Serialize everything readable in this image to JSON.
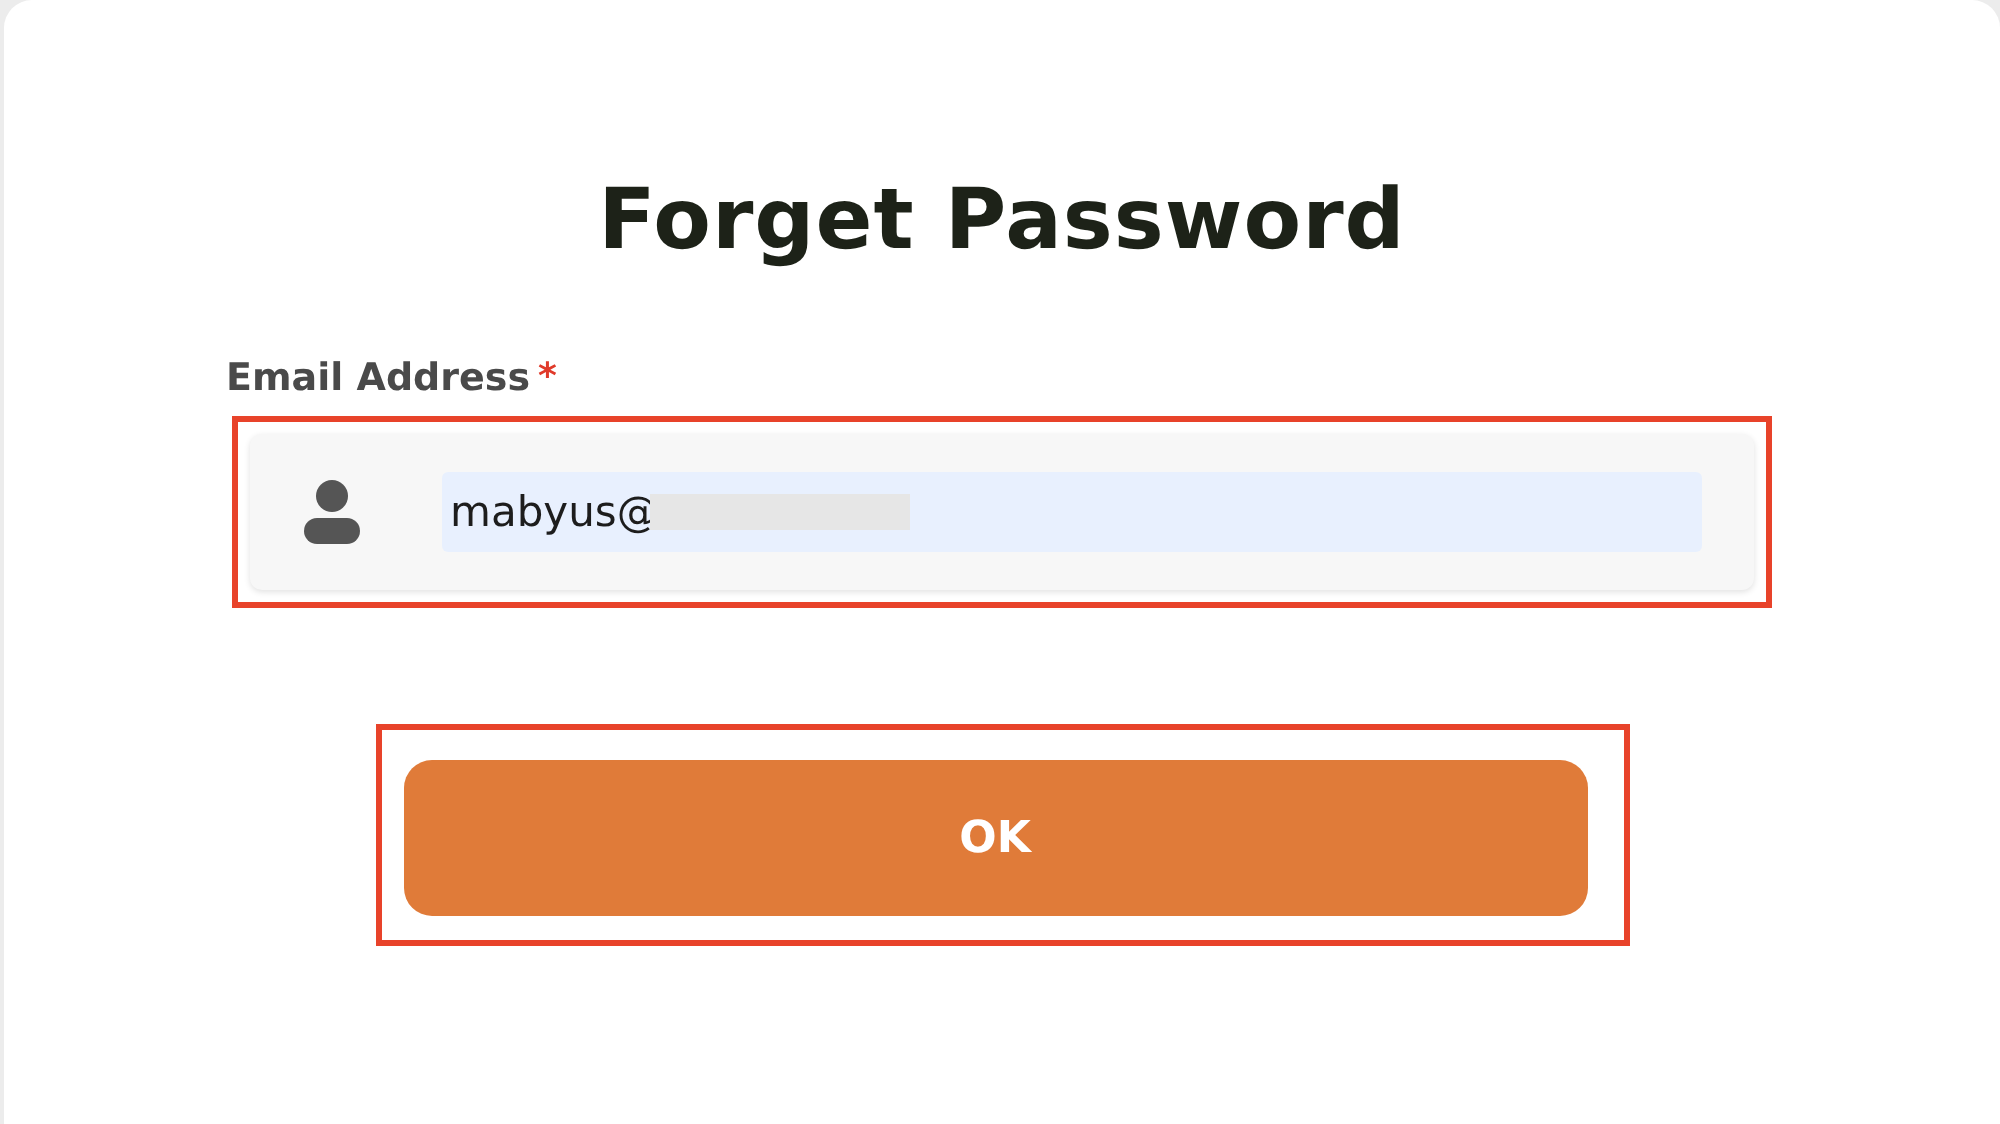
{
  "title": "Forget Password",
  "email_field": {
    "label": "Email Address",
    "required_mark": "*",
    "value": "mabyus@",
    "value_redacted": true,
    "highlighted": true
  },
  "submit_button": {
    "label": "OK",
    "highlighted": true
  }
}
